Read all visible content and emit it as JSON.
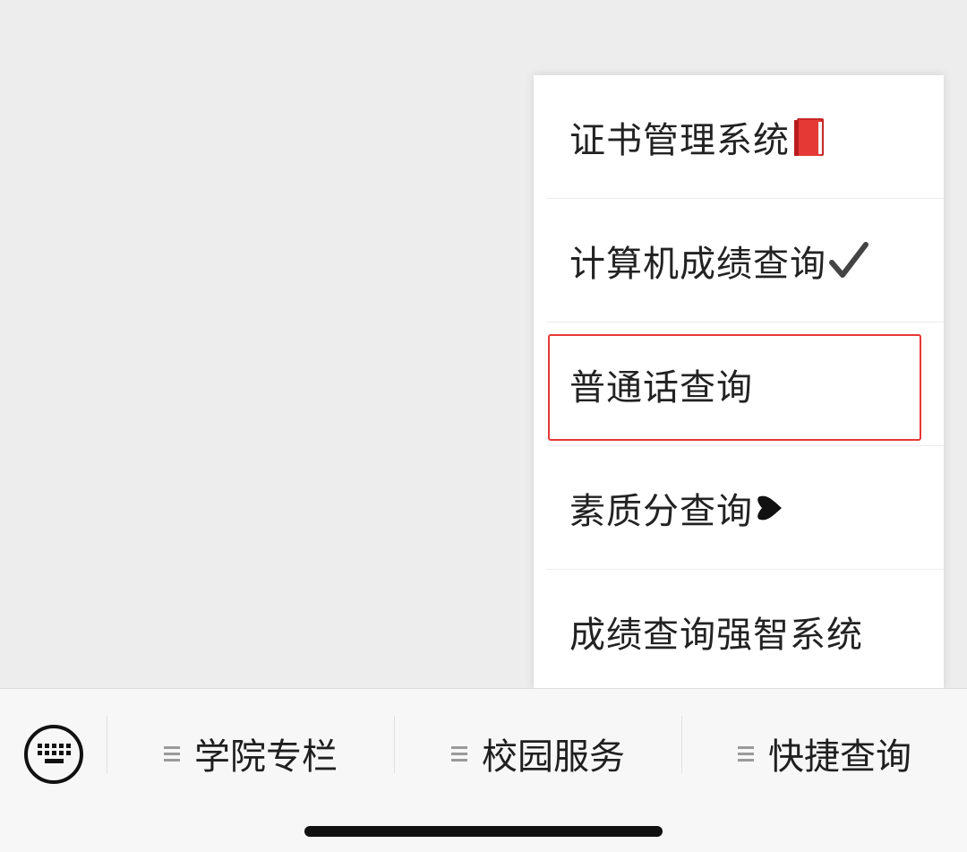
{
  "popup_menu": {
    "items": [
      {
        "label": "证书管理系统",
        "icon": "red-book-icon"
      },
      {
        "label": "计算机成绩查询",
        "icon": "check-mark-icon"
      },
      {
        "label": "普通话查询",
        "icon": ""
      },
      {
        "label": "素质分查询",
        "icon": "black-heart-suit-icon"
      },
      {
        "label": "成绩查询强智系统",
        "icon": ""
      }
    ],
    "highlighted_index": 2,
    "highlight_color": "#e53935"
  },
  "bottom_bar": {
    "keyboard_icon": "keyboard-icon",
    "tabs": [
      {
        "label": "学院专栏"
      },
      {
        "label": "校园服务"
      },
      {
        "label": "快捷查询"
      }
    ]
  }
}
